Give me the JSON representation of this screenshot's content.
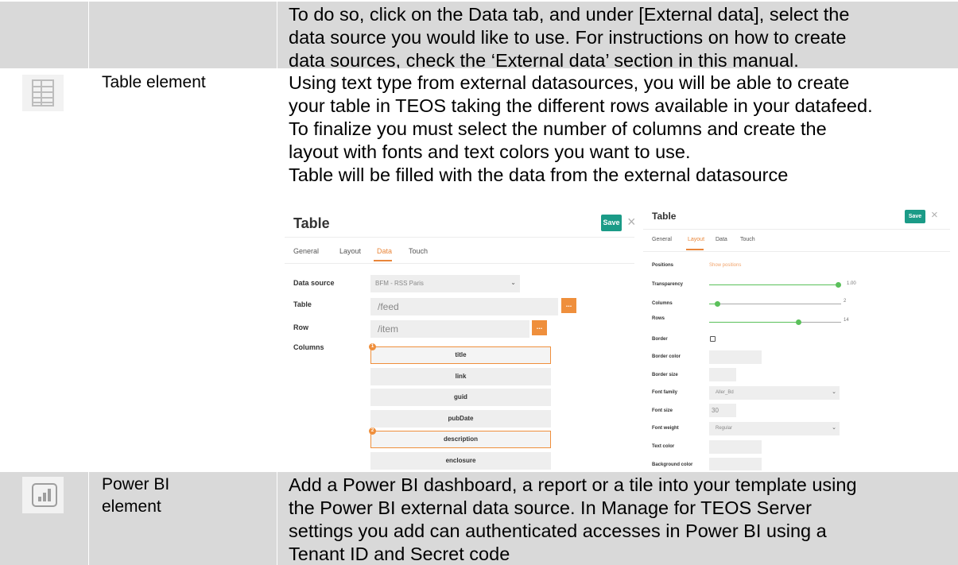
{
  "rows": [
    {
      "label": "",
      "lines": [
        "To do so, click on the Data tab, and under [External data], select the",
        "data source you would like to use. For instructions on how to create",
        "data sources, check the ‘External data’ section in this manual."
      ]
    },
    {
      "label": "Table element",
      "icon": "table-grid-icon",
      "lines": [
        "Using text type from external datasources, you will be able to create",
        "your table in TEOS taking the different rows available in your datafeed.",
        "To finalize you must select the number of columns and create the",
        "layout with fonts and text colors you want to use.",
        "Table will be filled with the data from the external datasource"
      ]
    },
    {
      "label_lines": [
        "Power BI",
        "element"
      ],
      "icon": "power-bi-chart-icon",
      "lines": [
        "Add a Power BI dashboard, a report or a tile into your template using",
        "the Power BI external data source. In Manage for TEOS Server",
        "settings you add can authenticated accesses in Power BI using a",
        "Tenant ID and Secret code"
      ]
    }
  ],
  "data_shot": {
    "title": "Table",
    "save_label": "Save",
    "close_glyph": "×",
    "tabs": [
      "General",
      "Layout",
      "Data",
      "Touch"
    ],
    "active_tab": "Data",
    "fields": {
      "data_source_label": "Data source",
      "data_source_value": "BFM - RSS Paris",
      "table_label": "Table",
      "table_value": "/feed",
      "row_label": "Row",
      "row_value": "/item",
      "columns_label": "Columns"
    },
    "dots_label": "...",
    "columns": [
      "title",
      "link",
      "guid",
      "pubDate",
      "description",
      "enclosure"
    ],
    "badges": [
      "1",
      "2"
    ]
  },
  "layout_shot": {
    "title": "Table",
    "save_label": "Save",
    "close_glyph": "×",
    "tabs": [
      "General",
      "Layout",
      "Data",
      "Touch"
    ],
    "active_tab": "Layout",
    "positions_label": "Positions",
    "show_positions": "Show positions",
    "transparency_label": "Transparency",
    "transparency_value": "1.00",
    "columns_label": "Columns",
    "columns_value": "2",
    "rows_label": "Rows",
    "rows_value": "14",
    "border_label": "Border",
    "border_color_label": "Border color",
    "border_size_label": "Border size",
    "font_family_label": "Font family",
    "font_family_value": "Aller_Bd",
    "font_size_label": "Font size",
    "font_size_value": "30",
    "font_weight_label": "Font weight",
    "font_weight_value": "Regular",
    "text_color_label": "Text color",
    "background_color_label": "Background color"
  },
  "colors": {
    "cell_grey": "#d9d9d9",
    "save_green": "#1b9b87",
    "accent_orange": "#ef8f3c",
    "slider_green": "#5ac05a"
  }
}
